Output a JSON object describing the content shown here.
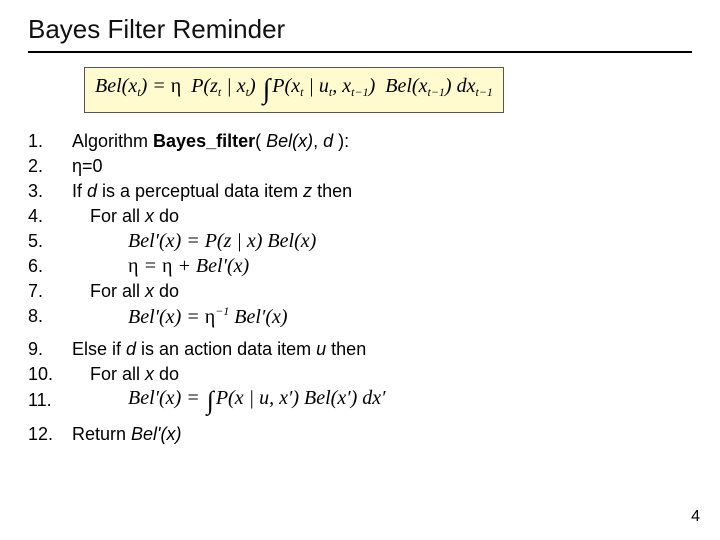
{
  "title": "Bayes Filter Reminder",
  "page_number": "4",
  "main_equation": "Bel(x_t) = η P(z_t | x_t) ∫ P(x_t | u_t, x_{t-1}) Bel(x_{t-1}) dx_{t-1}",
  "lines": [
    {
      "num": "1.",
      "a": "Algorithm ",
      "b": "Bayes_filter",
      "c": "( ",
      "d": "Bel(x)",
      "e": ", ",
      "f": "d",
      "g": " ):"
    },
    {
      "num": "2.",
      "text": "η=0"
    },
    {
      "num": "3.",
      "a": "If ",
      "b": "d",
      "c": " is a perceptual data item ",
      "d": "z",
      "e": " then"
    },
    {
      "num": "4.",
      "a": "For all ",
      "b": "x",
      "c": " do"
    },
    {
      "num": "5.",
      "eq": "Bel'(x) = P(z | x) Bel(x)"
    },
    {
      "num": "6.",
      "eq": "η = η + Bel'(x)"
    },
    {
      "num": "7.",
      "a": "For all ",
      "b": "x",
      "c": " do"
    },
    {
      "num": "8.",
      "eq": "Bel'(x) = η^{-1} Bel'(x)"
    },
    {
      "num": "9.",
      "a": "Else if ",
      "b": "d",
      "c": " is an action data item ",
      "d": "u",
      "e": " then"
    },
    {
      "num": "10.",
      "a": "For all ",
      "b": "x",
      "c": " do"
    },
    {
      "num": "11.",
      "eq": "Bel'(x) = ∫ P(x | u, x') Bel(x') dx'"
    },
    {
      "num": "12.",
      "a": "Return ",
      "b": "Bel'(x)"
    }
  ]
}
